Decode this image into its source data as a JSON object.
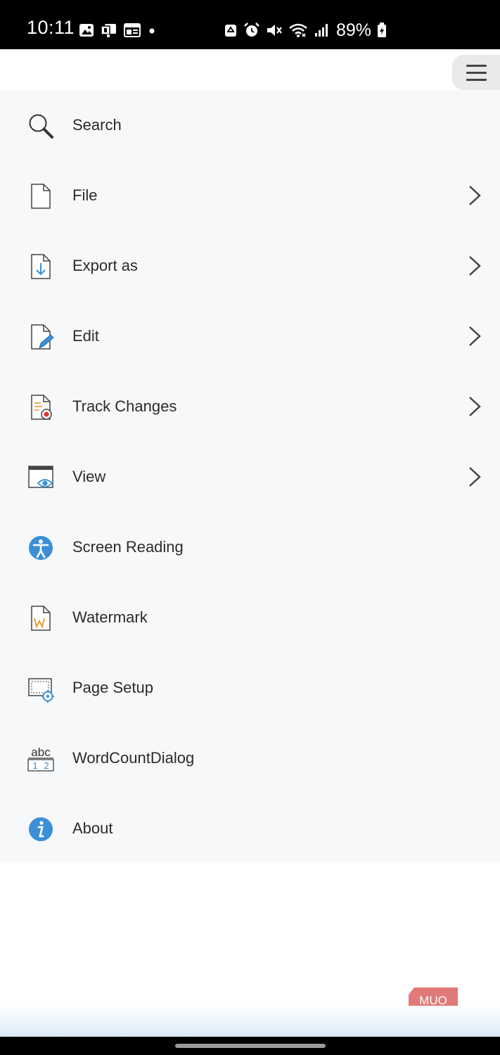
{
  "status_bar": {
    "time": "10:11",
    "battery_percent": "89%",
    "left_icons": [
      "gallery-icon",
      "teams-icon",
      "news-icon",
      "notification-dot-icon"
    ],
    "right_icons": [
      "recycle-icon",
      "alarm-icon",
      "mute-icon",
      "wifi-icon",
      "signal-icon",
      "battery-charging-icon"
    ]
  },
  "header": {
    "menu_icon": "hamburger-icon"
  },
  "menu": {
    "items": [
      {
        "label": "Search",
        "icon": "search-icon",
        "has_submenu": false
      },
      {
        "label": "File",
        "icon": "file-icon",
        "has_submenu": true
      },
      {
        "label": "Export as",
        "icon": "export-icon",
        "has_submenu": true
      },
      {
        "label": "Edit",
        "icon": "edit-icon",
        "has_submenu": true
      },
      {
        "label": "Track Changes",
        "icon": "track-changes-icon",
        "has_submenu": true
      },
      {
        "label": "View",
        "icon": "view-icon",
        "has_submenu": true
      },
      {
        "label": "Screen Reading",
        "icon": "accessibility-icon",
        "has_submenu": false
      },
      {
        "label": "Watermark",
        "icon": "watermark-icon",
        "has_submenu": false
      },
      {
        "label": "Page Setup",
        "icon": "page-setup-icon",
        "has_submenu": false
      },
      {
        "label": "WordCountDialog",
        "icon": "word-count-icon",
        "has_submenu": false
      },
      {
        "label": "About",
        "icon": "info-icon",
        "has_submenu": false
      }
    ]
  },
  "colors": {
    "accent_blue": "#3a8fd8",
    "record_red": "#e0312a",
    "watermark_orange": "#e8952c",
    "logo_red": "#e07a78"
  },
  "logo": {
    "text": "MUO"
  }
}
